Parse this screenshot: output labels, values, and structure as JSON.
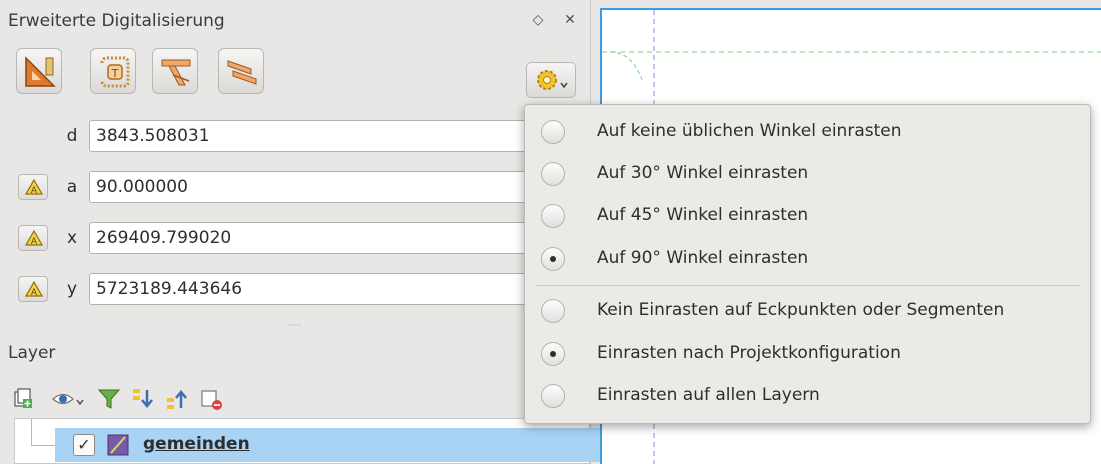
{
  "panel": {
    "title": "Erweiterte Digitalisierung",
    "float_glyph": "◇",
    "close_glyph": "✕",
    "tools": [
      "construction-tool-icon",
      "parallel-tool-icon",
      "perpendicular-tool-icon",
      "snap-tool-icon"
    ],
    "settings_icon": "gear-icon",
    "fields": [
      {
        "label": "d",
        "value": "3843.508031",
        "locked": false
      },
      {
        "label": "a",
        "value": "90.000000",
        "locked": true
      },
      {
        "label": "x",
        "value": "269409.799020",
        "locked": true
      },
      {
        "label": "y",
        "value": "5723189.443646",
        "locked": true
      }
    ]
  },
  "splitter_glyph": "·····",
  "layers": {
    "title": "Layer",
    "toolbar_icons": [
      "add-group-icon",
      "visibility-icon",
      "filter-icon",
      "expand-all-icon",
      "collapse-all-icon",
      "remove-layer-icon"
    ],
    "items": [
      {
        "name": "gemeinden",
        "checked": true,
        "check_glyph": "✓"
      }
    ]
  },
  "menu": {
    "items": [
      {
        "label": "Auf keine üblichen Winkel einrasten",
        "selected": false
      },
      {
        "label": "Auf 30° Winkel einrasten",
        "selected": false
      },
      {
        "label": "Auf 45° Winkel einrasten",
        "selected": false
      },
      {
        "label": "Auf 90° Winkel einrasten",
        "selected": true
      },
      {
        "label": "Kein Einrasten auf Eckpunkten oder Segmenten",
        "selected": false
      },
      {
        "label": "Einrasten nach Projektkonfiguration",
        "selected": true
      },
      {
        "label": "Einrasten auf allen Layern",
        "selected": false
      }
    ]
  },
  "colors": {
    "accent": "#3d9ce0",
    "selection": "#a9d3f5",
    "tool_orange": "#e07a2a"
  }
}
